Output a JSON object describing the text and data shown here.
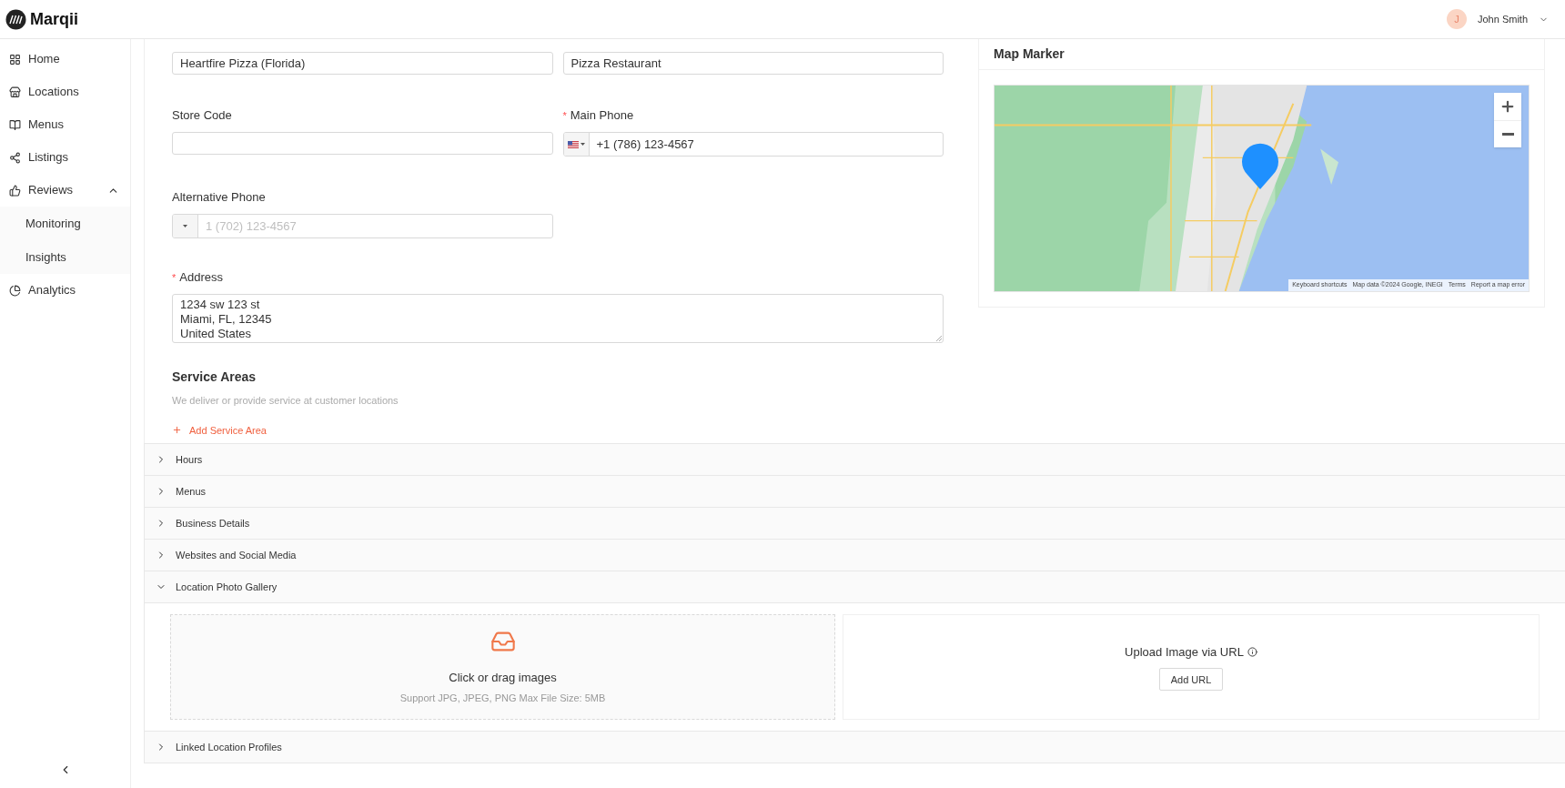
{
  "brand": {
    "name": "Marqii"
  },
  "user": {
    "initial": "J",
    "name": "John Smith"
  },
  "sidebar": {
    "items": [
      {
        "label": "Home"
      },
      {
        "label": "Locations"
      },
      {
        "label": "Menus"
      },
      {
        "label": "Listings"
      },
      {
        "label": "Reviews",
        "expanded": true,
        "children": [
          {
            "label": "Monitoring"
          },
          {
            "label": "Insights"
          }
        ]
      },
      {
        "label": "Analytics"
      }
    ]
  },
  "form": {
    "required_mark": "*",
    "fields": [
      {
        "kind": "text",
        "value": "Heartfire Pizza (Florida)"
      },
      {
        "kind": "text",
        "value": "Pizza Restaurant"
      },
      {
        "kind": "text",
        "label": "Store Code",
        "required": false
      },
      {
        "kind": "phone",
        "label": "Main Phone",
        "required": true,
        "flag": true,
        "value": "+1 (786) 123-4567"
      },
      {
        "kind": "phone",
        "label": "Alternative Phone",
        "required": false,
        "flag": false,
        "placeholder": "1 (702) 123-4567"
      },
      {
        "kind": "textarea",
        "label": "Address",
        "required": true,
        "lines": [
          "1234 sw 123 st",
          "Miami, FL, 12345",
          "United States"
        ]
      }
    ]
  },
  "service_areas": {
    "title": "Service Areas",
    "description": "We deliver or provide service at customer locations",
    "add_button": "Add Service Area"
  },
  "map": {
    "title": "Map Marker",
    "attribution": [
      "Keyboard shortcuts",
      "Map data ©2024 Google, INEGI",
      "Terms",
      "Report a map error"
    ]
  },
  "sections": [
    {
      "label": "Hours",
      "expanded": false
    },
    {
      "label": "Menus",
      "expanded": false
    },
    {
      "label": "Business Details",
      "expanded": false
    },
    {
      "label": "Websites and Social Media",
      "expanded": false
    },
    {
      "label": "Location Photo Gallery",
      "expanded": true,
      "upload": {
        "title": "Click or drag images",
        "hint": "Support JPG, JPEG, PNG Max File Size: 5MB",
        "url_title": "Upload Image via URL",
        "url_button": "Add URL"
      }
    },
    {
      "label": "Linked Location Profiles",
      "expanded": false
    }
  ]
}
